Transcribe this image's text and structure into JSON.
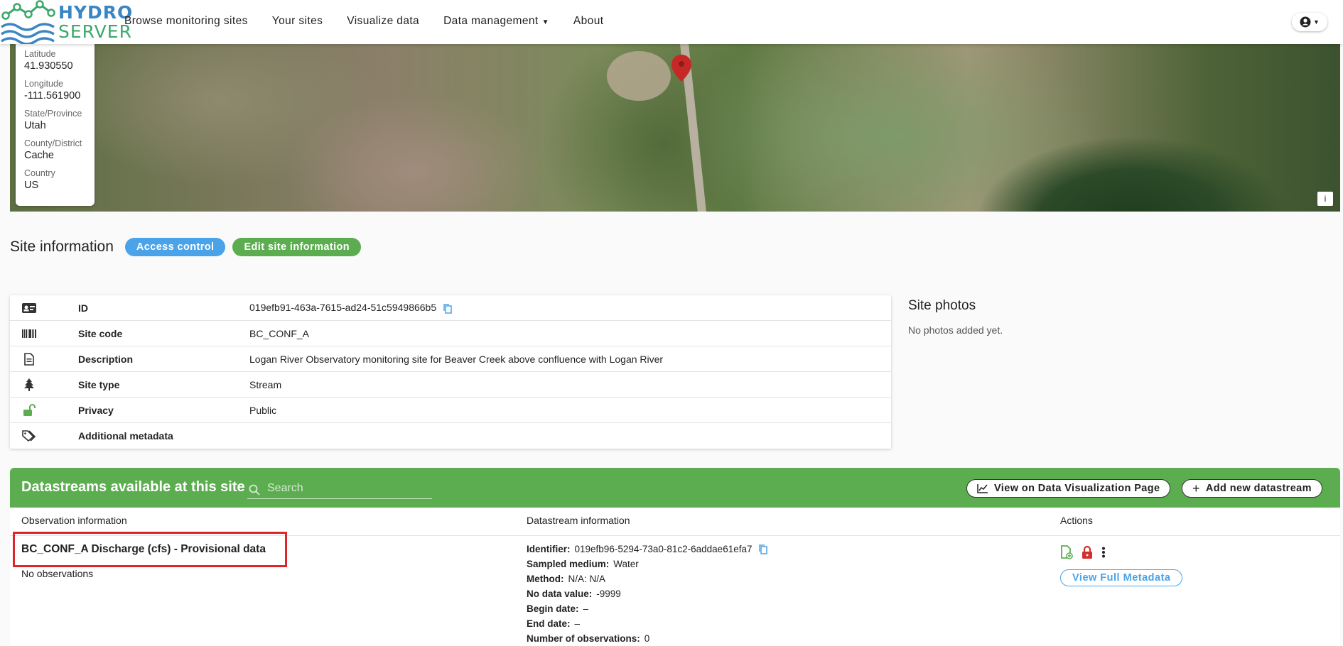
{
  "nav": {
    "logo_line1": "HYDRO",
    "logo_line2": "SERVER",
    "items": [
      "Browse monitoring sites",
      "Your sites",
      "Visualize data",
      "Data management",
      "About"
    ]
  },
  "map": {
    "info_label": "i",
    "coords": [
      {
        "label": "Latitude",
        "value": "41.930550"
      },
      {
        "label": "Longitude",
        "value": "-111.561900"
      },
      {
        "label": "State/Province",
        "value": "Utah"
      },
      {
        "label": "County/District",
        "value": "Cache"
      },
      {
        "label": "Country",
        "value": "US"
      }
    ]
  },
  "site": {
    "title": "Site information",
    "access_control": "Access control",
    "edit_info": "Edit site information",
    "rows": [
      {
        "key": "ID",
        "value": "019efb91-463a-7615-ad24-51c5949866b5"
      },
      {
        "key": "Site code",
        "value": "BC_CONF_A"
      },
      {
        "key": "Description",
        "value": "Logan River Observatory monitoring site for Beaver Creek above confluence with Logan River"
      },
      {
        "key": "Site type",
        "value": "Stream"
      },
      {
        "key": "Privacy",
        "value": "Public"
      },
      {
        "key": "Additional metadata",
        "value": ""
      }
    ]
  },
  "photos": {
    "title": "Site photos",
    "empty": "No photos added yet."
  },
  "datastreams": {
    "title": "Datastreams available at this site",
    "search_placeholder": "Search",
    "view_viz": "View on Data Visualization Page",
    "add_new": "Add new datastream",
    "columns": [
      "Observation information",
      "Datastream information",
      "Actions"
    ],
    "item": {
      "name": "BC_CONF_A Discharge (cfs) - Provisional data",
      "no_obs": "No observations",
      "identifier_label": "Identifier:",
      "identifier": "019efb96-5294-73a0-81c2-6addae61efa7",
      "medium_label": "Sampled medium:",
      "medium": "Water",
      "method_label": "Method:",
      "method": "N/A: N/A",
      "nodata_label": "No data value:",
      "nodata": "-9999",
      "begin_label": "Begin date:",
      "begin": "–",
      "end_label": "End date:",
      "end": "–",
      "count_label": "Number of observations:",
      "count": "0",
      "view_meta": "View Full Metadata"
    }
  },
  "colors": {
    "green": "#5cad50",
    "blue": "#4aa3e8",
    "highlight": "#e0242b",
    "lock_red": "#d32f2f"
  }
}
